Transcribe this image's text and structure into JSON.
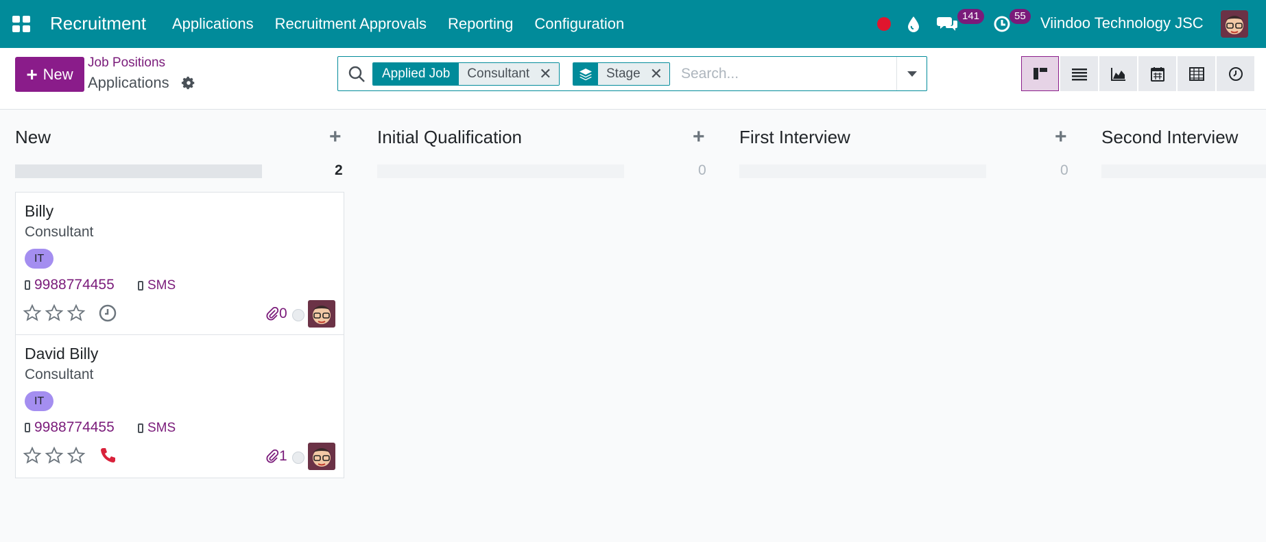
{
  "navbar": {
    "app_title": "Recruitment",
    "menu": [
      "Applications",
      "Recruitment Approvals",
      "Reporting",
      "Configuration"
    ],
    "messages_count": "141",
    "activities_count": "55",
    "company": "Viindoo Technology JSC",
    "colors": {
      "bar": "#018b9a",
      "badge": "#7a1b7a",
      "record": "#e0162e"
    }
  },
  "control": {
    "new_label": "New",
    "breadcrumb_parent": "Job Positions",
    "breadcrumb_current": "Applications",
    "search": {
      "facets": [
        {
          "label": "Applied Job",
          "value": "Consultant"
        },
        {
          "icon": "layers-icon",
          "value": "Stage"
        }
      ],
      "placeholder": "Search..."
    },
    "views": [
      "kanban",
      "list",
      "graph",
      "calendar",
      "pivot",
      "activity"
    ],
    "active_view": "kanban"
  },
  "kanban": {
    "columns": [
      {
        "title": "New",
        "count": "2"
      },
      {
        "title": "Initial Qualification",
        "count": "0"
      },
      {
        "title": "First Interview",
        "count": "0"
      },
      {
        "title": "Second Interview",
        "count": ""
      }
    ],
    "cards": [
      {
        "name": "Billy",
        "job": "Consultant",
        "tag": "IT",
        "phone": "9988774455",
        "sms": "SMS",
        "attachments": "0",
        "activity": "clock-icon"
      },
      {
        "name": "David Billy",
        "job": "Consultant",
        "tag": "IT",
        "phone": "9988774455",
        "sms": "SMS",
        "attachments": "1",
        "activity": "phone-icon"
      }
    ]
  }
}
